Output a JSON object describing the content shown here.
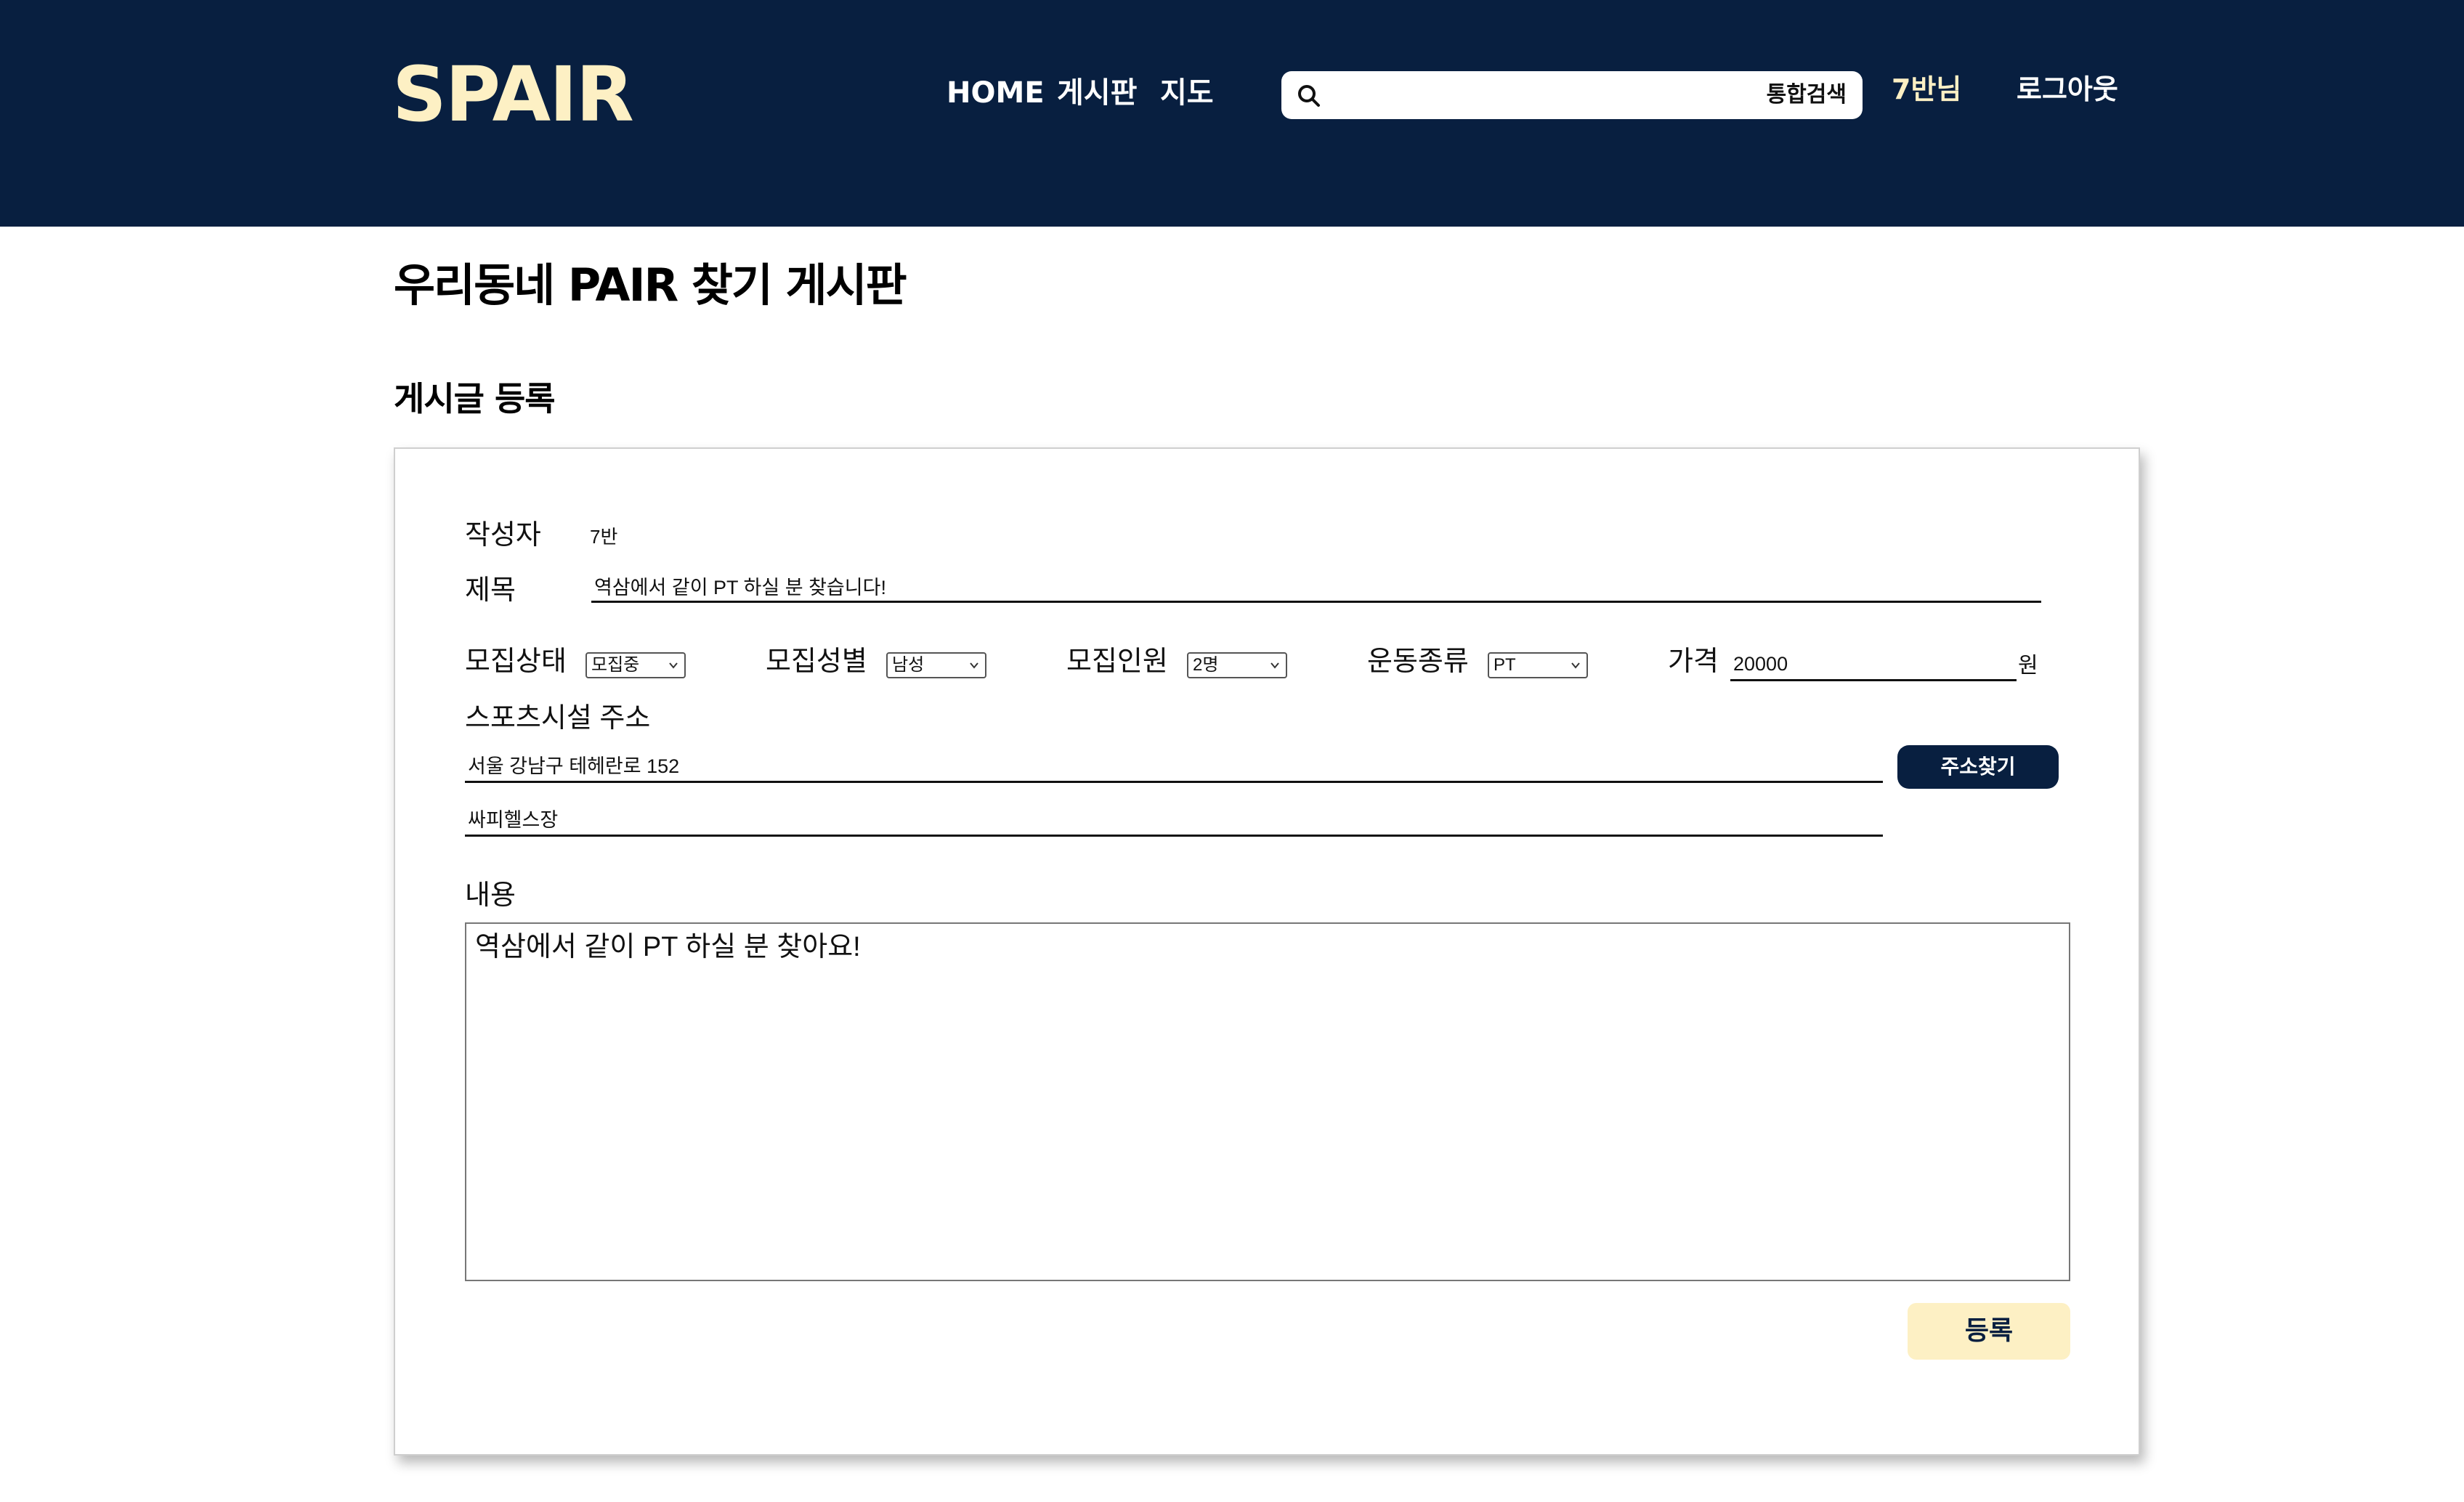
{
  "header": {
    "logo": "SPAIR",
    "nav": [
      {
        "label": "HOME"
      },
      {
        "label": "게시판"
      },
      {
        "label": "지도"
      }
    ],
    "search": {
      "placeholder": "",
      "button_label": "통합검색"
    },
    "user_label": "7반님",
    "logout_label": "로그아웃"
  },
  "page": {
    "title": "우리동네 PAIR 찾기 게시판",
    "section_title": "게시글 등록"
  },
  "form": {
    "author_label": "작성자",
    "author_value": "7반",
    "title_label": "제목",
    "title_value": "역삼에서 같이 PT 하실 분 찾습니다!",
    "status_label": "모집상태",
    "status_value": "모집중",
    "gender_label": "모집성별",
    "gender_value": "남성",
    "count_label": "모집인원",
    "count_value": "2명",
    "exercise_label": "운동종류",
    "exercise_value": "PT",
    "price_label": "가격",
    "price_value": "20000",
    "price_unit": "원",
    "address_label": "스포츠시설 주소",
    "address_value": "서울 강남구 테헤란로 152",
    "facility_value": "싸피헬스장",
    "address_button_label": "주소찾기",
    "content_label": "내용",
    "content_value": "역삼에서 같이 PT 하실 분 찾아요!",
    "submit_label": "등록"
  },
  "colors": {
    "header_bg": "#081f40",
    "accent": "#fdf0c4"
  }
}
